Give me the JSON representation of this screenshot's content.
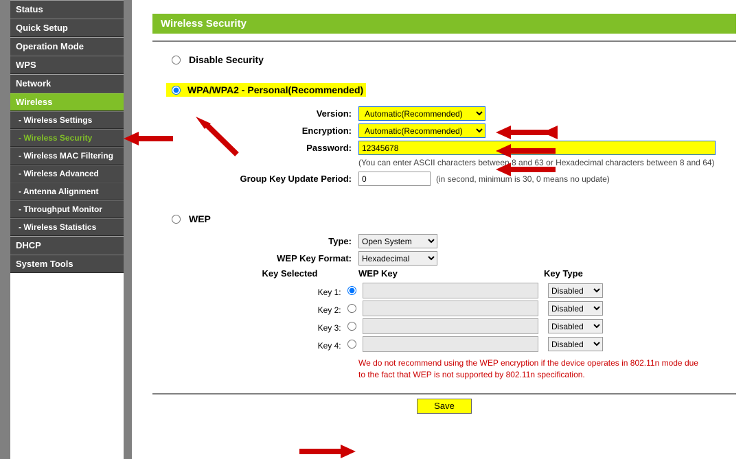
{
  "sidebar": {
    "items": [
      {
        "label": "Status"
      },
      {
        "label": "Quick Setup"
      },
      {
        "label": "Operation Mode"
      },
      {
        "label": "WPS"
      },
      {
        "label": "Network"
      },
      {
        "label": "Wireless",
        "active": true,
        "subs": [
          {
            "label": "- Wireless Settings"
          },
          {
            "label": "- Wireless Security",
            "active": true
          },
          {
            "label": "- Wireless MAC Filtering"
          },
          {
            "label": "- Wireless Advanced"
          },
          {
            "label": "- Antenna Alignment"
          },
          {
            "label": "- Throughput Monitor"
          },
          {
            "label": "- Wireless Statistics"
          }
        ]
      },
      {
        "label": "DHCP"
      },
      {
        "label": "System Tools"
      }
    ]
  },
  "page": {
    "title": "Wireless Security",
    "disable_label": "Disable Security",
    "wpa_label": "WPA/WPA2 - Personal(Recommended)",
    "wpa": {
      "version_label": "Version:",
      "version_value": "Automatic(Recommended)",
      "encryption_label": "Encryption:",
      "encryption_value": "Automatic(Recommended)",
      "password_label": "Password:",
      "password_value": "12345678",
      "password_hint": "(You can enter ASCII characters between 8 and 63 or Hexadecimal characters between 8 and 64)",
      "gkup_label": "Group Key Update Period:",
      "gkup_value": "0",
      "gkup_hint": "(in second, minimum is 30, 0 means no update)"
    },
    "wep_label": "WEP",
    "wep": {
      "type_label": "Type:",
      "type_value": "Open System",
      "format_label": "WEP Key Format:",
      "format_value": "Hexadecimal",
      "col_selected": "Key Selected",
      "col_key": "WEP Key",
      "col_type": "Key Type",
      "keys": [
        {
          "label": "Key 1:",
          "type": "Disabled"
        },
        {
          "label": "Key 2:",
          "type": "Disabled"
        },
        {
          "label": "Key 3:",
          "type": "Disabled"
        },
        {
          "label": "Key 4:",
          "type": "Disabled"
        }
      ],
      "warning": "We do not recommend using the WEP encryption if the device operates in 802.11n mode due to the fact that WEP is not supported by 802.11n specification."
    },
    "save_label": "Save"
  }
}
